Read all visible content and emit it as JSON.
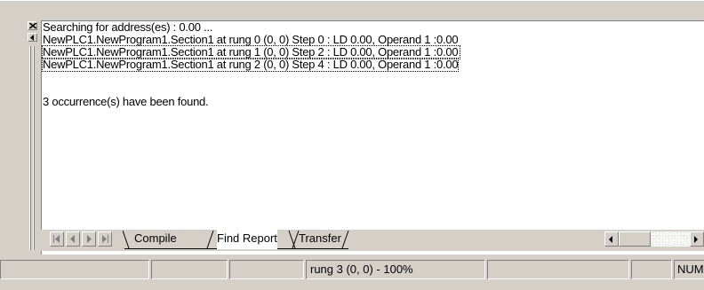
{
  "output": {
    "lines": [
      "Searching for address(es) : 0.00 ...",
      "NewPLC1.NewProgram1.Section1 at rung 0 (0, 0) Step 0 : LD 0.00, Operand 1 :0.00",
      "NewPLC1.NewProgram1.Section1 at rung 1 (0, 0) Step 2 : LD 0.00, Operand 1 :0.00",
      "NewPLC1.NewProgram1.Section1 at rung 2 (0, 0) Step 4 : LD 0.00, Operand 1 :0.00",
      "",
      "3 occurrence(s) have been found."
    ],
    "selected_line": 3
  },
  "tabs": [
    {
      "label": "Compile",
      "active": false
    },
    {
      "label": "Find Report",
      "active": true
    },
    {
      "label": "Transfer",
      "active": false
    }
  ],
  "statusbar": {
    "panels": [
      "",
      "",
      "",
      "rung 3 (0, 0)  - 100%",
      "",
      "",
      "NUM"
    ]
  },
  "icons": {
    "close": "close-icon",
    "dock_arrow": "arrow-left-icon",
    "tab_first": "first-tab-icon",
    "tab_prev": "prev-tab-icon",
    "tab_next": "next-tab-icon",
    "tab_last": "last-tab-icon",
    "scroll_left": "scroll-left-icon",
    "scroll_right": "scroll-right-icon"
  }
}
